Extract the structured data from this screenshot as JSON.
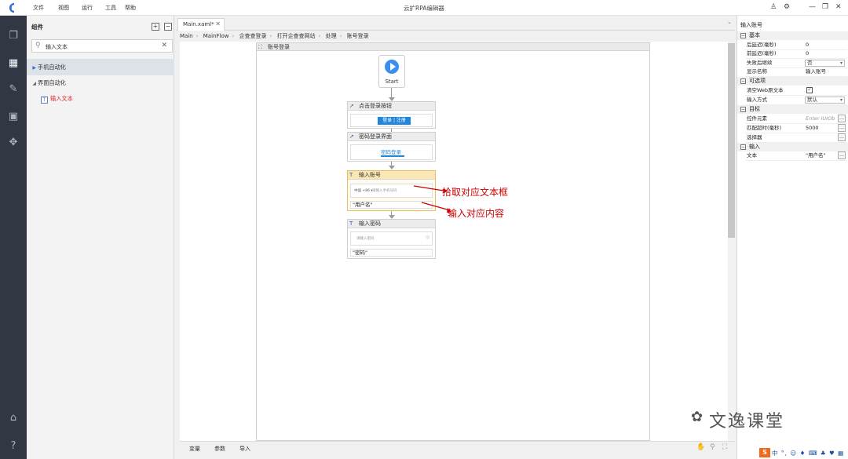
{
  "app": {
    "title": "云扩RPA编辑器"
  },
  "menu": [
    "文件",
    "视图",
    "运行",
    "工具",
    "帮助"
  ],
  "components_panel": {
    "title": "组件",
    "search_value": "输入文本",
    "tree": {
      "mobile": "手机自动化",
      "ui": "界面自动化",
      "input_text": "输入文本"
    }
  },
  "editor": {
    "tab_label": "Main.xaml*",
    "breadcrumb": [
      "Main",
      "MainFlow",
      "企查查登录",
      "打开企查查网站",
      "处理",
      "账号登录"
    ],
    "sequence_title": "账号登录",
    "start_label": "Start",
    "activities": {
      "click_login": {
        "title": "点击登录按钮",
        "button": "登录 | 注册"
      },
      "pwd_login": {
        "title": "密码登录界面",
        "tab": "密码登录"
      },
      "input_account": {
        "title": "输入账号",
        "prefix": "中国 +86 ▾",
        "placeholder": "请输入手机号码",
        "value": "\"用户名\""
      },
      "input_password": {
        "title": "输入密码",
        "placeholder": "请输入密码",
        "value": "\"密码\""
      }
    },
    "bottom_tabs": [
      "变量",
      "参数",
      "导入"
    ]
  },
  "annotations": {
    "pick_textbox": "拾取对应文本框",
    "input_content": "输入对应内容"
  },
  "properties": {
    "title": "输入账号",
    "groups": {
      "basic": {
        "label": "基本",
        "delay_after": "后延迟(毫秒)",
        "delay_after_val": "0",
        "delay_before": "前延迟(毫秒)",
        "delay_before_val": "0",
        "continue_on_error": "失败后继续",
        "continue_on_error_val": "否",
        "display_name": "显示名称",
        "display_name_val": "输入账号"
      },
      "optional": {
        "label": "可选项",
        "clear_web": "清空Web原文本",
        "input_method": "输入方式",
        "input_method_val": "默认"
      },
      "target": {
        "label": "目标",
        "control": "控件元素",
        "control_ph": "Enter IUIOb",
        "timeout": "匹配超时(毫秒)",
        "timeout_val": "5000",
        "selector": "选择器"
      },
      "input": {
        "label": "输入",
        "text": "文本",
        "text_val": "\"用户名\""
      }
    }
  },
  "watermark": "文逸课堂",
  "tray": "中 °, ☺ ♦ ⌨ ♣ ♥ ▦"
}
